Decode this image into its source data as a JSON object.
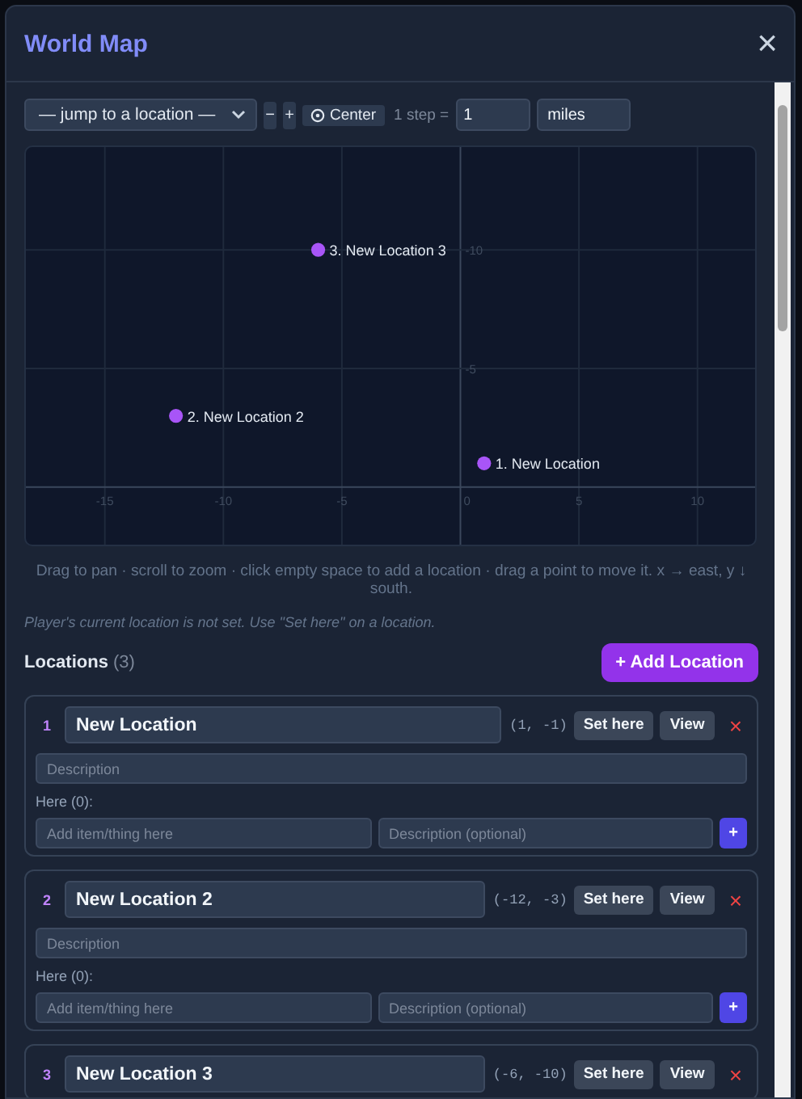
{
  "window": {
    "title": "World Map",
    "close": "×"
  },
  "toolbar": {
    "jump_select": "— jump to a location —",
    "zoom_out": "−",
    "zoom_in": "+",
    "center": "Center",
    "step_label": "1 step =",
    "step_value": "1",
    "unit_value": "miles"
  },
  "map": {
    "chart_data": {
      "type": "scatter",
      "x": [
        1,
        -12,
        -6
      ],
      "series": [
        {
          "color": "#a855f7",
          "values": [
            -1,
            -3,
            -10
          ]
        }
      ],
      "value_labels": [
        "1. New Location",
        "2. New Location 2",
        "3. New Location 3"
      ],
      "xlim": [
        -18.4,
        12.5
      ],
      "ylim": [
        2.5,
        -14.4
      ],
      "xticks": [
        -15,
        -10,
        -5,
        0,
        5,
        10
      ],
      "yticks": [
        -10,
        -5
      ],
      "grid": true
    }
  },
  "hint": "Drag to pan · scroll to zoom · click empty space to add a location · drag a point to move it. x → east, y ↓ south.",
  "note": "Player's current location is not set. Use \"Set here\" on a location.",
  "locations_header": {
    "title": "Locations",
    "count": "(3)",
    "add_button": "+ Add Location"
  },
  "locations": [
    {
      "number": "1",
      "name": "New Location",
      "coords": "(1, -1)",
      "set_here": "Set here",
      "view": "View",
      "delete": "×",
      "description_placeholder": "Description",
      "here_label": "Here (0):",
      "item_placeholder": "Add item/thing here",
      "item_description_placeholder": "Description (optional)",
      "add_item": "+"
    },
    {
      "number": "2",
      "name": "New Location 2",
      "coords": "(-12, -3)",
      "set_here": "Set here",
      "view": "View",
      "delete": "×",
      "description_placeholder": "Description",
      "here_label": "Here (0):",
      "item_placeholder": "Add item/thing here",
      "item_description_placeholder": "Description (optional)",
      "add_item": "+"
    },
    {
      "number": "3",
      "name": "New Location 3",
      "coords": "(-6, -10)",
      "set_here": "Set here",
      "view": "View",
      "delete": "×"
    }
  ]
}
